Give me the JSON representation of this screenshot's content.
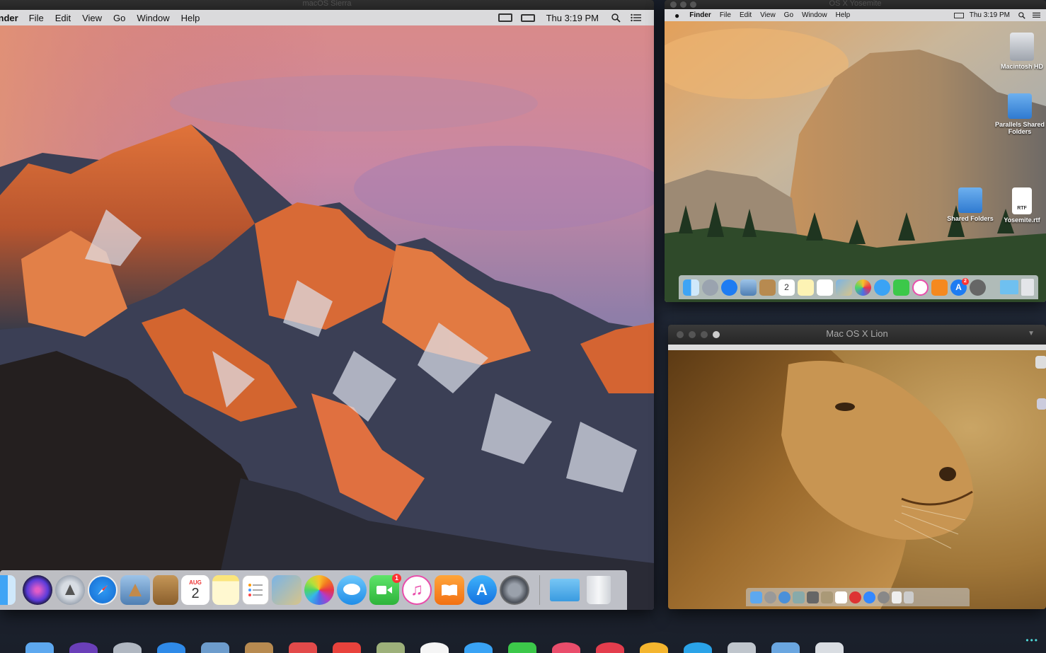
{
  "sierra": {
    "title": "macOS Sierra",
    "menu": [
      "Finder",
      "File",
      "Edit",
      "View",
      "Go",
      "Window",
      "Help"
    ],
    "clock": "Thu 3:19 PM",
    "calendar_month": "AUG",
    "calendar_day": "2",
    "facetime_badge": "1",
    "dock_icons": [
      "finder-icon",
      "siri-icon",
      "launchpad-icon",
      "safari-icon",
      "mail-icon",
      "contacts-icon",
      "calendar-icon",
      "notes-icon",
      "reminders-icon",
      "preview-icon",
      "photos-icon",
      "messages-icon",
      "facetime-icon",
      "itunes-icon",
      "ibooks-icon",
      "app-store-icon",
      "system-preferences-icon",
      "downloads-icon",
      "trash-icon"
    ]
  },
  "yosemite": {
    "title": "OS X Yosemite",
    "menu": [
      "Finder",
      "File",
      "Edit",
      "View",
      "Go",
      "Window",
      "Help"
    ],
    "clock": "Thu 3:19 PM",
    "calendar_day": "2",
    "appstore_badge": "2",
    "desktop_icons": [
      {
        "label": "Macintosh HD",
        "icon": "hard-drive-icon"
      },
      {
        "label": "Parallels Shared Folders",
        "icon": "shared-folder-icon"
      },
      {
        "label": "Shared Folders",
        "icon": "shared-folder-icon"
      },
      {
        "label": "Yosemite.rtf",
        "icon": "rtf-document-icon"
      }
    ],
    "rtf_label": "RTF",
    "dock_icons": [
      "finder-icon",
      "launchpad-icon",
      "safari-icon",
      "mail-icon",
      "contacts-icon",
      "calendar-icon",
      "notes-icon",
      "reminders-icon",
      "preview-icon",
      "photos-icon",
      "messages-icon",
      "facetime-icon",
      "itunes-icon",
      "ibooks-icon",
      "app-store-icon",
      "system-preferences-icon",
      "downloads-icon",
      "trash-icon"
    ]
  },
  "lion": {
    "title": "Mac OS X Lion",
    "dock_icons": [
      "finder-icon",
      "launchpad-icon",
      "safari-icon",
      "mail-icon",
      "facetime-icon",
      "contacts-icon",
      "calendar-icon",
      "itunes-icon",
      "app-store-icon",
      "system-preferences-icon",
      "documents-icon",
      "trash-icon"
    ]
  },
  "host_dock_icons": [
    "finder-icon",
    "siri-icon",
    "launchpad-icon",
    "safari-icon",
    "mail-icon",
    "contacts-icon",
    "calendar-icon",
    "notes-icon",
    "reminders-icon",
    "photos-icon",
    "messages-icon",
    "facetime-icon",
    "itunes-icon",
    "ibooks-icon",
    "app-store-icon",
    "parallels-icon",
    "windows-icon",
    "folder-icon",
    "trash-icon"
  ],
  "colors": {
    "accent_blue": "#1e7cf2",
    "badge_red": "#ff3b30",
    "titlebar": "#2a2a2a"
  }
}
